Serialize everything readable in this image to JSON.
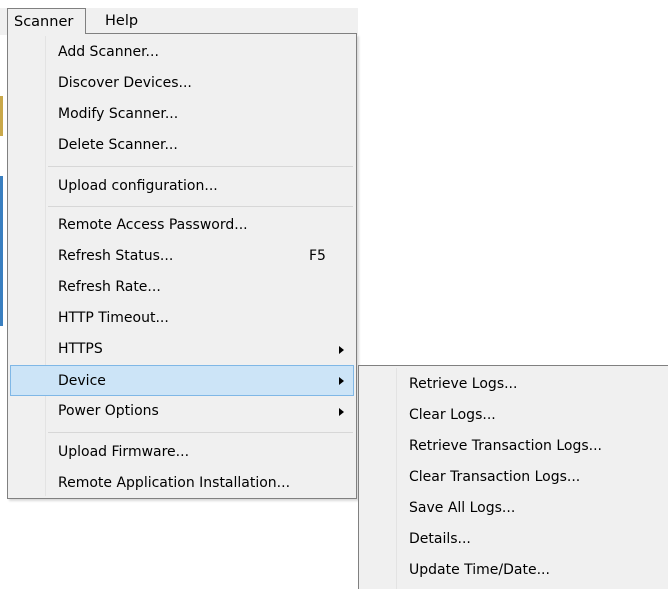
{
  "menubar": {
    "items": [
      {
        "label": "Scanner"
      },
      {
        "label": "Help"
      }
    ]
  },
  "scanner_menu": {
    "items": [
      {
        "label": "Add Scanner..."
      },
      {
        "label": "Discover Devices..."
      },
      {
        "label": "Modify Scanner..."
      },
      {
        "label": "Delete Scanner..."
      },
      {
        "label": "Upload configuration..."
      },
      {
        "label": "Remote Access Password..."
      },
      {
        "label": "Refresh Status...",
        "shortcut": "F5"
      },
      {
        "label": "Refresh Rate..."
      },
      {
        "label": "HTTP Timeout..."
      },
      {
        "label": "HTTPS",
        "has_submenu": true
      },
      {
        "label": "Device",
        "has_submenu": true,
        "selected": true
      },
      {
        "label": "Power Options",
        "has_submenu": true
      },
      {
        "label": "Upload Firmware..."
      },
      {
        "label": "Remote Application Installation..."
      }
    ]
  },
  "device_submenu": {
    "items": [
      {
        "label": "Retrieve Logs..."
      },
      {
        "label": "Clear Logs..."
      },
      {
        "label": "Retrieve Transaction Logs..."
      },
      {
        "label": "Clear Transaction Logs..."
      },
      {
        "label": "Save All Logs..."
      },
      {
        "label": "Details..."
      },
      {
        "label": "Update Time/Date..."
      }
    ]
  },
  "colors": {
    "menu_background": "#f0f0f0",
    "border": "#808080",
    "highlight_fill": "#cce4f7",
    "highlight_border": "#7fb7e6"
  }
}
